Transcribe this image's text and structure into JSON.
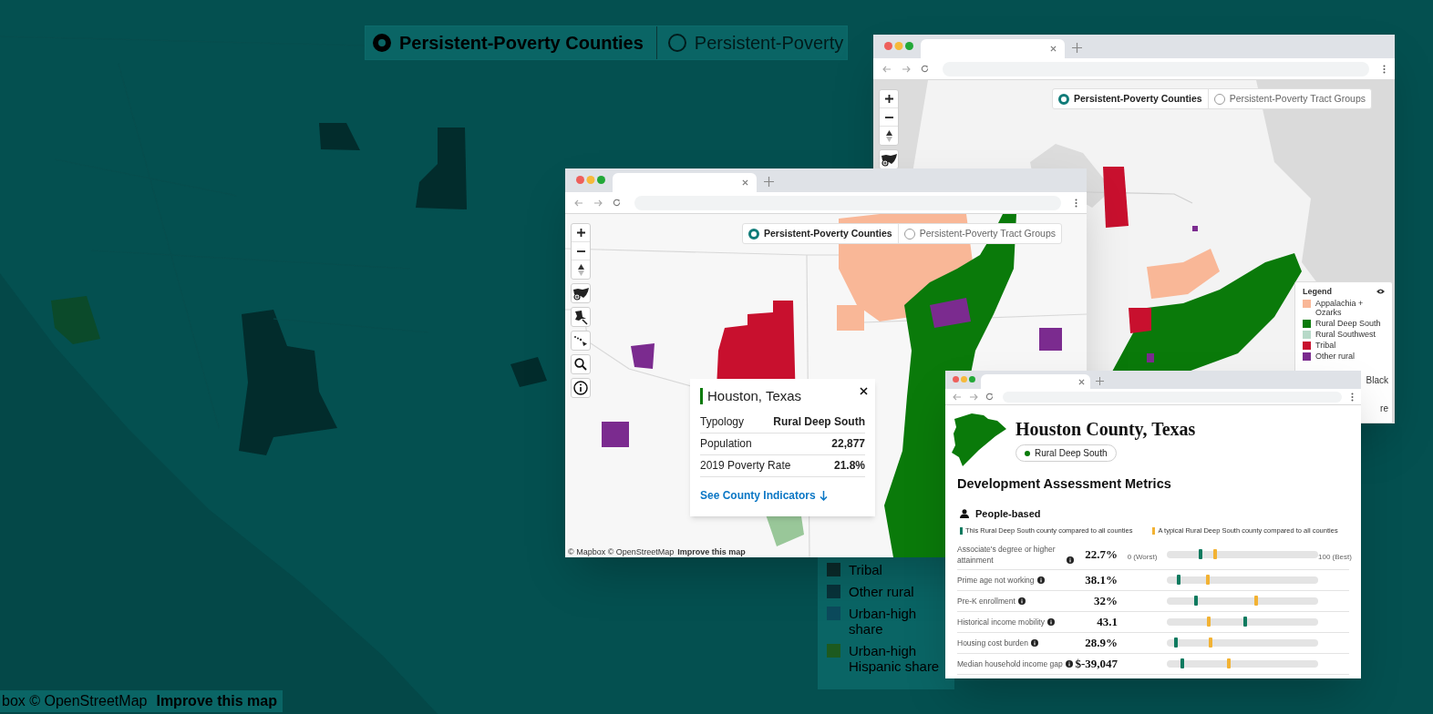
{
  "background": {
    "toggle": [
      {
        "label": "Persistent-Poverty Counties",
        "selected": true
      },
      {
        "label": "Persistent-Poverty",
        "selected": false
      }
    ],
    "legend": [
      {
        "label": "Tribal",
        "color": "#0b2b2b"
      },
      {
        "label": "Other rural",
        "color": "#08323a"
      },
      {
        "label": "Urban-high share",
        "color": "#0c4a5c"
      },
      {
        "label": "Urban-high Hispanic share",
        "color": "#1d5a1f"
      }
    ],
    "attribution": "box © OpenStreetMap",
    "attribution_link": "Improve this map"
  },
  "national_map_window": {
    "toggle": [
      {
        "label": "Persistent-Poverty Counties",
        "selected": true
      },
      {
        "label": "Persistent-Poverty Tract Groups",
        "selected": false
      }
    ],
    "legend": {
      "title": "Legend",
      "items": [
        {
          "label": "Appalachia + Ozarks",
          "color": "#f9b797"
        },
        {
          "label": "Rural Deep South",
          "color": "#0a7a0a"
        },
        {
          "label": "Rural Southwest",
          "color": "#b7d9c8"
        },
        {
          "label": "Tribal",
          "color": "#c8102e"
        },
        {
          "label": "Other rural",
          "color": "#7b2b8f"
        }
      ],
      "fragments": [
        "Black",
        "re"
      ]
    }
  },
  "regional_map_window": {
    "toggle": [
      {
        "label": "Persistent-Poverty Counties",
        "selected": true
      },
      {
        "label": "Persistent-Poverty Tract Groups",
        "selected": false
      }
    ],
    "popup": {
      "title": "Houston, Texas",
      "rows": [
        {
          "label": "Typology",
          "value": "Rural Deep South"
        },
        {
          "label": "Population",
          "value": "22,877"
        },
        {
          "label": "2019 Poverty Rate",
          "value": "21.8%"
        }
      ],
      "link": "See County Indicators"
    },
    "attribution": "© Mapbox © OpenStreetMap",
    "attribution_link": "Improve this map"
  },
  "county_window": {
    "title": "Houston County, Texas",
    "typology": "Rural Deep South",
    "section_title": "Development Assessment Metrics",
    "group": "People-based",
    "legend": [
      {
        "kind": "county",
        "label": "This Rural Deep South county compared to all counties"
      },
      {
        "kind": "typical",
        "label": "A typical Rural Deep South county compared to all counties"
      }
    ],
    "scale": {
      "min_label": "0 (Worst)",
      "max_label": "100 (Best)"
    },
    "metrics": [
      {
        "label": "Associate's degree or higher attainment",
        "value": "22.7%",
        "markers": [
          {
            "kind": "county",
            "level": 0.22
          },
          {
            "kind": "typical",
            "level": 0.32
          }
        ]
      },
      {
        "label": "Prime age not working",
        "value": "38.1%",
        "markers": [
          {
            "kind": "county",
            "level": 0.08
          },
          {
            "kind": "typical",
            "level": 0.27
          }
        ]
      },
      {
        "label": "Pre-K enrollment",
        "value": "32%",
        "markers": [
          {
            "kind": "county",
            "level": 0.19
          },
          {
            "kind": "typical",
            "level": 0.59
          }
        ]
      },
      {
        "label": "Historical income mobility",
        "value": "43.1",
        "markers": [
          {
            "kind": "typical",
            "level": 0.28
          },
          {
            "kind": "county",
            "level": 0.52
          }
        ]
      },
      {
        "label": "Housing cost burden",
        "value": "28.9%",
        "markers": [
          {
            "kind": "county",
            "level": 0.06
          },
          {
            "kind": "typical",
            "level": 0.29
          }
        ]
      },
      {
        "label": "Median household income gap",
        "value": "$-39,047",
        "markers": [
          {
            "kind": "county",
            "level": 0.1
          },
          {
            "kind": "typical",
            "level": 0.41
          }
        ]
      }
    ]
  }
}
